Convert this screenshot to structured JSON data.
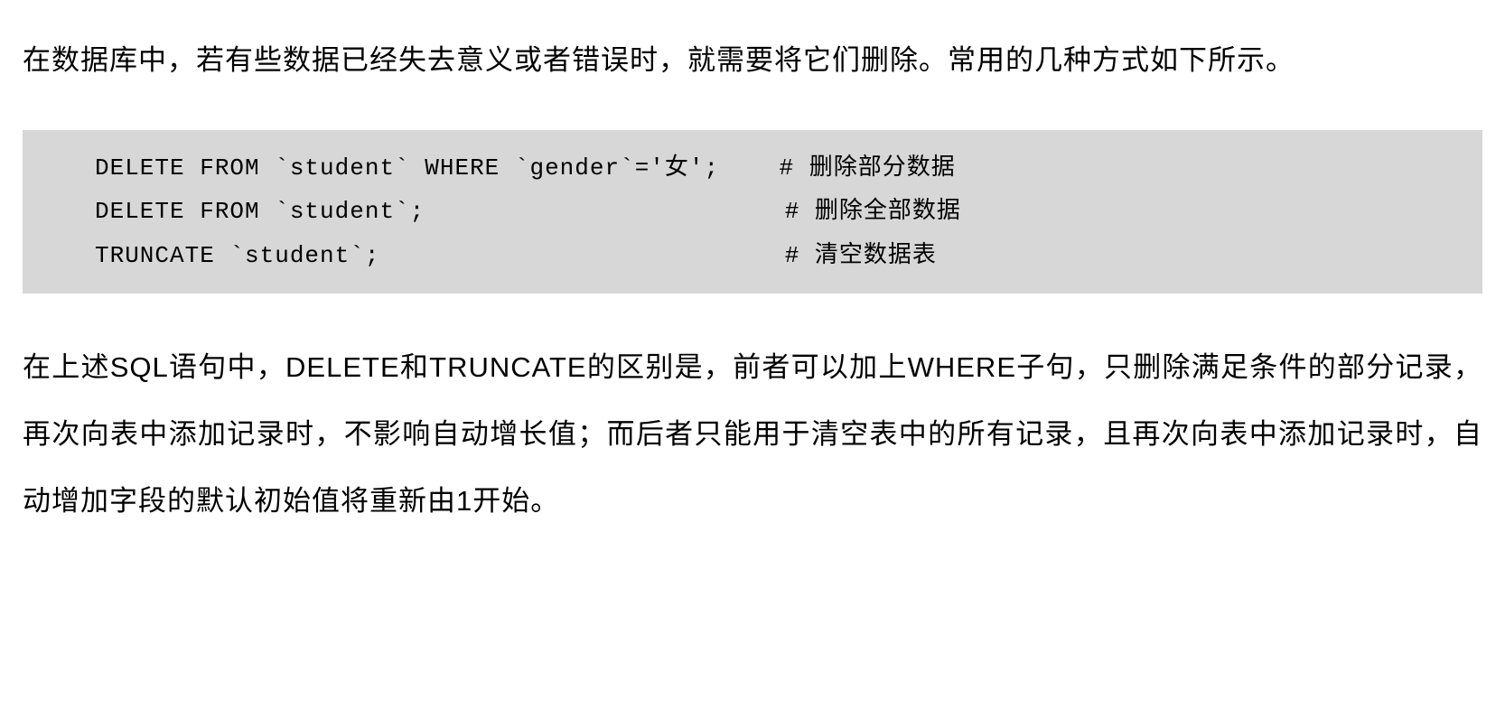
{
  "intro_paragraph": "在数据库中，若有些数据已经失去意义或者错误时，就需要将它们删除。常用的几种方式如下所示。",
  "code": {
    "lines": [
      {
        "command": "DELETE FROM `student` WHERE `gender`='女';",
        "padded": "DELETE FROM `student` WHERE `gender`='女';    ",
        "comment": "# 删除部分数据"
      },
      {
        "command": "DELETE FROM `student`;",
        "padded": "DELETE FROM `student`;                        ",
        "comment": "# 删除全部数据"
      },
      {
        "command": "TRUNCATE `student`;",
        "padded": "TRUNCATE `student`;                           ",
        "comment": "# 清空数据表"
      }
    ]
  },
  "outro_paragraph": "在上述SQL语句中，DELETE和TRUNCATE的区别是，前者可以加上WHERE子句，只删除满足条件的部分记录，再次向表中添加记录时，不影响自动增长值；而后者只能用于清空表中的所有记录，且再次向表中添加记录时，自动增加字段的默认初始值将重新由1开始。"
}
